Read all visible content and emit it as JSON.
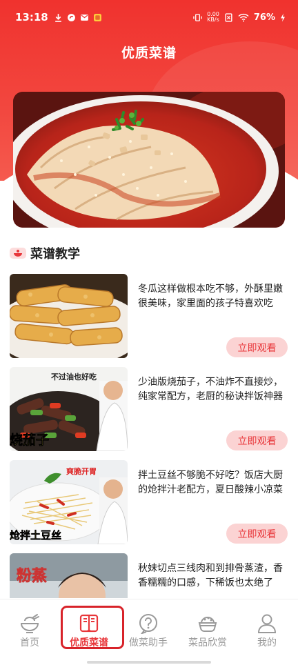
{
  "status_bar": {
    "time": "13:18",
    "net_speed_value": "0.00",
    "net_speed_unit": "KB/s",
    "battery": "76%"
  },
  "header": {
    "title": "优质菜谱"
  },
  "section": {
    "title": "菜谱教学"
  },
  "recipes": [
    {
      "description": "冬瓜这样做根本吃不够，外酥里嫩很美味，家里面的孩子特喜欢吃",
      "button": "立即观看"
    },
    {
      "description": "少油版烧茄子，不油炸不直接炒，纯家常配方，老厨的秘诀拌饭神器",
      "button": "立即观看",
      "thumb_caption_top": "不过油也好吃",
      "thumb_caption_bottom": "烧茄子"
    },
    {
      "description": "拌土豆丝不够脆不好吃？饭店大厨的炝拌汁老配方，夏日酸辣小凉菜",
      "button": "立即观看",
      "thumb_caption_top": "爽脆开胃",
      "thumb_caption_bottom": "炝拌土豆丝"
    },
    {
      "description": "秋妹切点三线肉和到排骨蒸渣，香香糯糯的口感，下稀饭也太绝了",
      "thumb_caption_top": "粉蒸"
    }
  ],
  "tabs": [
    {
      "label": "首页",
      "icon": "bowl-icon"
    },
    {
      "label": "优质菜谱",
      "icon": "recipe-book-icon",
      "active": true
    },
    {
      "label": "做菜助手",
      "icon": "question-icon"
    },
    {
      "label": "菜品欣赏",
      "icon": "dish-icon"
    },
    {
      "label": "我的",
      "icon": "user-icon"
    }
  ],
  "colors": {
    "primary_red": "#f0322e",
    "accent": "#e8363a",
    "button_bg": "#fbd3d3"
  }
}
